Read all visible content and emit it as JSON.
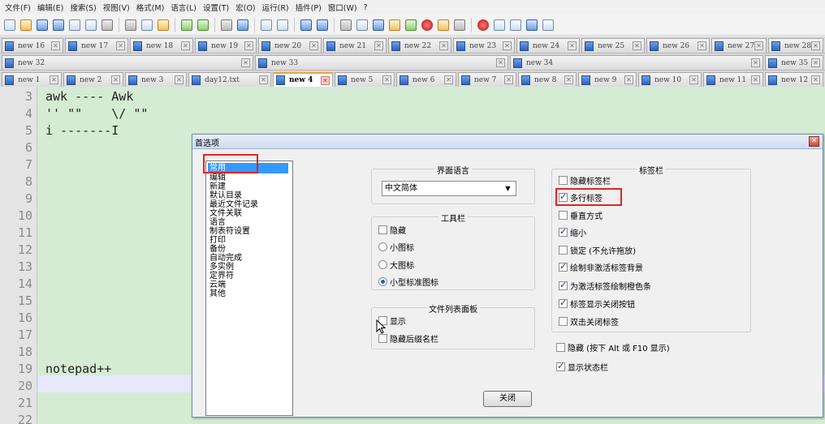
{
  "menu": [
    "文件(F)",
    "编辑(E)",
    "搜索(S)",
    "视图(V)",
    "格式(M)",
    "语言(L)",
    "设置(T)",
    "宏(O)",
    "运行(R)",
    "插件(P)",
    "窗口(W)",
    "?"
  ],
  "toolbar_icons": [
    "new-file-icon",
    "open-file-icon",
    "save-icon",
    "save-all-icon",
    "close-icon",
    "close-all-icon",
    "print-icon",
    "cut-icon",
    "copy-icon",
    "paste-icon",
    "undo-icon",
    "redo-icon",
    "find-icon",
    "replace-icon",
    "zoom-in-icon",
    "zoom-out-icon",
    "sync-v-icon",
    "sync-h-icon",
    "wrap-icon",
    "all-chars-icon",
    "indent-guide-icon",
    "udl-icon",
    "doc-map-icon",
    "function-list-icon",
    "folder-workspace-icon",
    "monitor-icon",
    "record-macro-icon",
    "stop-macro-icon",
    "play-macro-icon",
    "run-macro-icon",
    "save-macro-icon"
  ],
  "tabs_row1": [
    "new 16",
    "new 17",
    "new 18",
    "new 19",
    "new 20",
    "new 21",
    "new 22",
    "new 23",
    "new 24",
    "new 25",
    "new 26",
    "new 27",
    "new 28"
  ],
  "tabs_row2": [
    "new 32",
    "new 33",
    "new 34",
    "new 35"
  ],
  "tabs_row3": [
    "new 1",
    "new 2",
    "new 3",
    "day12.txt",
    "new 4",
    "new 5",
    "new 6",
    "new 7",
    "new 8",
    "new 9",
    "new 10",
    "new 11",
    "new 12"
  ],
  "active_tab": "new 4",
  "tab_close_glyph": "✕",
  "editor": {
    "line_numbers": [
      "3",
      "4",
      "5",
      "6",
      "7",
      "8",
      "9",
      "10",
      "11",
      "12",
      "13",
      "14",
      "15",
      "16",
      "17",
      "18",
      "19",
      "20",
      "21",
      "22"
    ],
    "lines": {
      "l3": "awk ---- Awk",
      "l4": "'' \"\"    \\/ \"\"",
      "l5": "i -------I",
      "l19": "notepad++"
    }
  },
  "dialog": {
    "title": "首选项",
    "close_glyph": "✕",
    "categories": [
      "常用",
      "编辑",
      "新建",
      "默认目录",
      "最近文件记录",
      "文件关联",
      "语言",
      "制表符设置",
      "打印",
      "备份",
      "自动完成",
      "多实例",
      "定界符",
      "云端",
      "其他"
    ],
    "selected_category": "常用",
    "ui_language": {
      "title": "界面语言",
      "value": "中文简体"
    },
    "toolbar": {
      "title": "工具栏",
      "hide": "隐藏",
      "small": "小图标",
      "large": "大图标",
      "standard": "小型标准图标",
      "selected": "小型标准图标"
    },
    "doc_list": {
      "title": "文件列表面板",
      "show": "显示",
      "hide_ext": "隐藏后缀名栏"
    },
    "tabbar": {
      "title": "标签栏",
      "options": [
        {
          "label": "隐藏标签栏",
          "checked": false
        },
        {
          "label": "多行标签",
          "checked": true
        },
        {
          "label": "垂直方式",
          "checked": false
        },
        {
          "label": "缩小",
          "checked": true
        },
        {
          "label": "锁定 (不允许拖放)",
          "checked": false
        },
        {
          "label": "绘制非激活标签背景",
          "checked": true
        },
        {
          "label": "为激活标签绘制橙色条",
          "checked": true
        },
        {
          "label": "标签显示关闭按钮",
          "checked": true
        },
        {
          "label": "双击关闭标签",
          "checked": false
        }
      ]
    },
    "hide_menu": "隐藏 (按下 Alt 或 F10 显示)",
    "show_status": "显示状态栏",
    "close_button": "关闭"
  }
}
